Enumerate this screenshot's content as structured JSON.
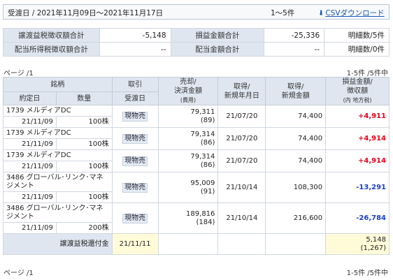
{
  "header": {
    "period": "受渡日 / 2021年11月09日～2021年11月17日",
    "range": "1～5件",
    "csv_label": "CSVダウンロード",
    "csv_icon": "download-arrow-icon"
  },
  "summary": {
    "row1": {
      "label1": "譲渡益税徴収額合計",
      "value1": "-5,148",
      "label2": "損益金額合計",
      "value2": "-25,336",
      "detail": "明細数/5件"
    },
    "row2": {
      "label1": "配当所得税徴収額合計",
      "value1": "--",
      "label2": "配当金額合計",
      "value2": "--",
      "detail": "明細数/0件"
    }
  },
  "page_top": {
    "left": "ページ /1",
    "right": "1-5件 /5件中"
  },
  "page_bottom": {
    "left": "ページ /1",
    "right": "1-5件 /5件中"
  },
  "table": {
    "headers": {
      "issue": "銘柄",
      "trade": "取引",
      "sale_amount": "売却/\n決済金額",
      "sale_amount_note": "(費用)",
      "acq_date": "取得/\n新規年月日",
      "acq_amount": "取得/\n新規金額",
      "pl": "損益金額/\n徴収額",
      "pl_note": "(内 地方税)",
      "contract_date": "約定日",
      "quantity": "数量",
      "settle_date": "受渡日"
    },
    "rows": [
      {
        "name": "1739 メルディアDC",
        "trade": "現物売",
        "sale": "79,311",
        "cost": "(89)",
        "acq_date": "21/07/20",
        "acq_amount": "74,400",
        "pl": "+4,911",
        "sign": "plus",
        "contract": "21/11/09",
        "qty": "100株",
        "settle": "21/11/11"
      },
      {
        "name": "1739 メルディアDC",
        "trade": "現物売",
        "sale": "79,314",
        "cost": "(86)",
        "acq_date": "21/07/20",
        "acq_amount": "74,400",
        "pl": "+4,914",
        "sign": "plus",
        "contract": "21/11/09",
        "qty": "100株",
        "settle": "21/11/11"
      },
      {
        "name": "1739 メルディアDC",
        "trade": "現物売",
        "sale": "79,314",
        "cost": "(86)",
        "acq_date": "21/07/20",
        "acq_amount": "74,400",
        "pl": "+4,914",
        "sign": "plus",
        "contract": "21/11/09",
        "qty": "100株",
        "settle": "21/11/11"
      },
      {
        "name": "3486 グローバル･リンク･マネ\nジメント",
        "trade": "現物売",
        "sale": "95,009",
        "cost": "(91)",
        "acq_date": "21/10/14",
        "acq_amount": "108,300",
        "pl": "-13,291",
        "sign": "minus",
        "contract": "21/11/09",
        "qty": "100株",
        "settle": "21/11/11"
      },
      {
        "name": "3486 グローバル･リンク･マネ\nジメント",
        "trade": "現物売",
        "sale": "189,816",
        "cost": "(184)",
        "acq_date": "21/10/14",
        "acq_amount": "216,600",
        "pl": "-26,784",
        "sign": "minus",
        "contract": "21/11/09",
        "qty": "200株",
        "settle": "21/11/11"
      }
    ],
    "footer": {
      "label": "譲渡益税還付金",
      "date": "21/11/11",
      "amount": "5,148",
      "local": "(1,267)"
    }
  }
}
